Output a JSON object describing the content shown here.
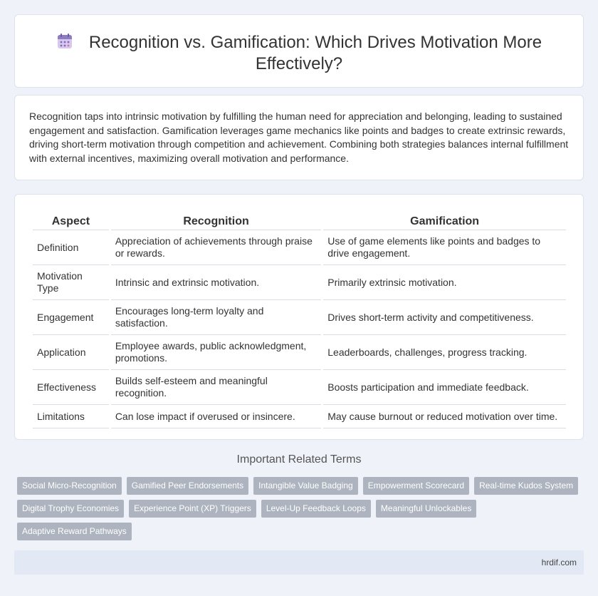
{
  "header": {
    "icon": "calendar-icon",
    "title": "Recognition vs. Gamification: Which Drives Motivation More Effectively?"
  },
  "summary": {
    "text": "Recognition taps into intrinsic motivation by fulfilling the human need for appreciation and belonging, leading to sustained engagement and satisfaction. Gamification leverages game mechanics like points and badges to create extrinsic rewards, driving short-term motivation through competition and achievement. Combining both strategies balances internal fulfillment with external incentives, maximizing overall motivation and performance."
  },
  "table": {
    "headers": [
      "Aspect",
      "Recognition",
      "Gamification"
    ],
    "rows": [
      [
        "Definition",
        "Appreciation of achievements through praise or rewards.",
        "Use of game elements like points and badges to drive engagement."
      ],
      [
        "Motivation Type",
        "Intrinsic and extrinsic motivation.",
        "Primarily extrinsic motivation."
      ],
      [
        "Engagement",
        "Encourages long-term loyalty and satisfaction.",
        "Drives short-term activity and competitiveness."
      ],
      [
        "Application",
        "Employee awards, public acknowledgment, promotions.",
        "Leaderboards, challenges, progress tracking."
      ],
      [
        "Effectiveness",
        "Builds self-esteem and meaningful recognition.",
        "Boosts participation and immediate feedback."
      ],
      [
        "Limitations",
        "Can lose impact if overused or insincere.",
        "May cause burnout or reduced motivation over time."
      ]
    ]
  },
  "related": {
    "heading": "Important Related Terms",
    "terms": [
      "Social Micro-Recognition",
      "Gamified Peer Endorsements",
      "Intangible Value Badging",
      "Empowerment Scorecard",
      "Real-time Kudos System",
      "Digital Trophy Economies",
      "Experience Point (XP) Triggers",
      "Level-Up Feedback Loops",
      "Meaningful Unlockables",
      "Adaptive Reward Pathways"
    ]
  },
  "footer": {
    "site": "hrdif.com"
  },
  "colors": {
    "background": "#eff2f8",
    "tag": "#adb4bf",
    "footer": "#e3e9f4"
  }
}
